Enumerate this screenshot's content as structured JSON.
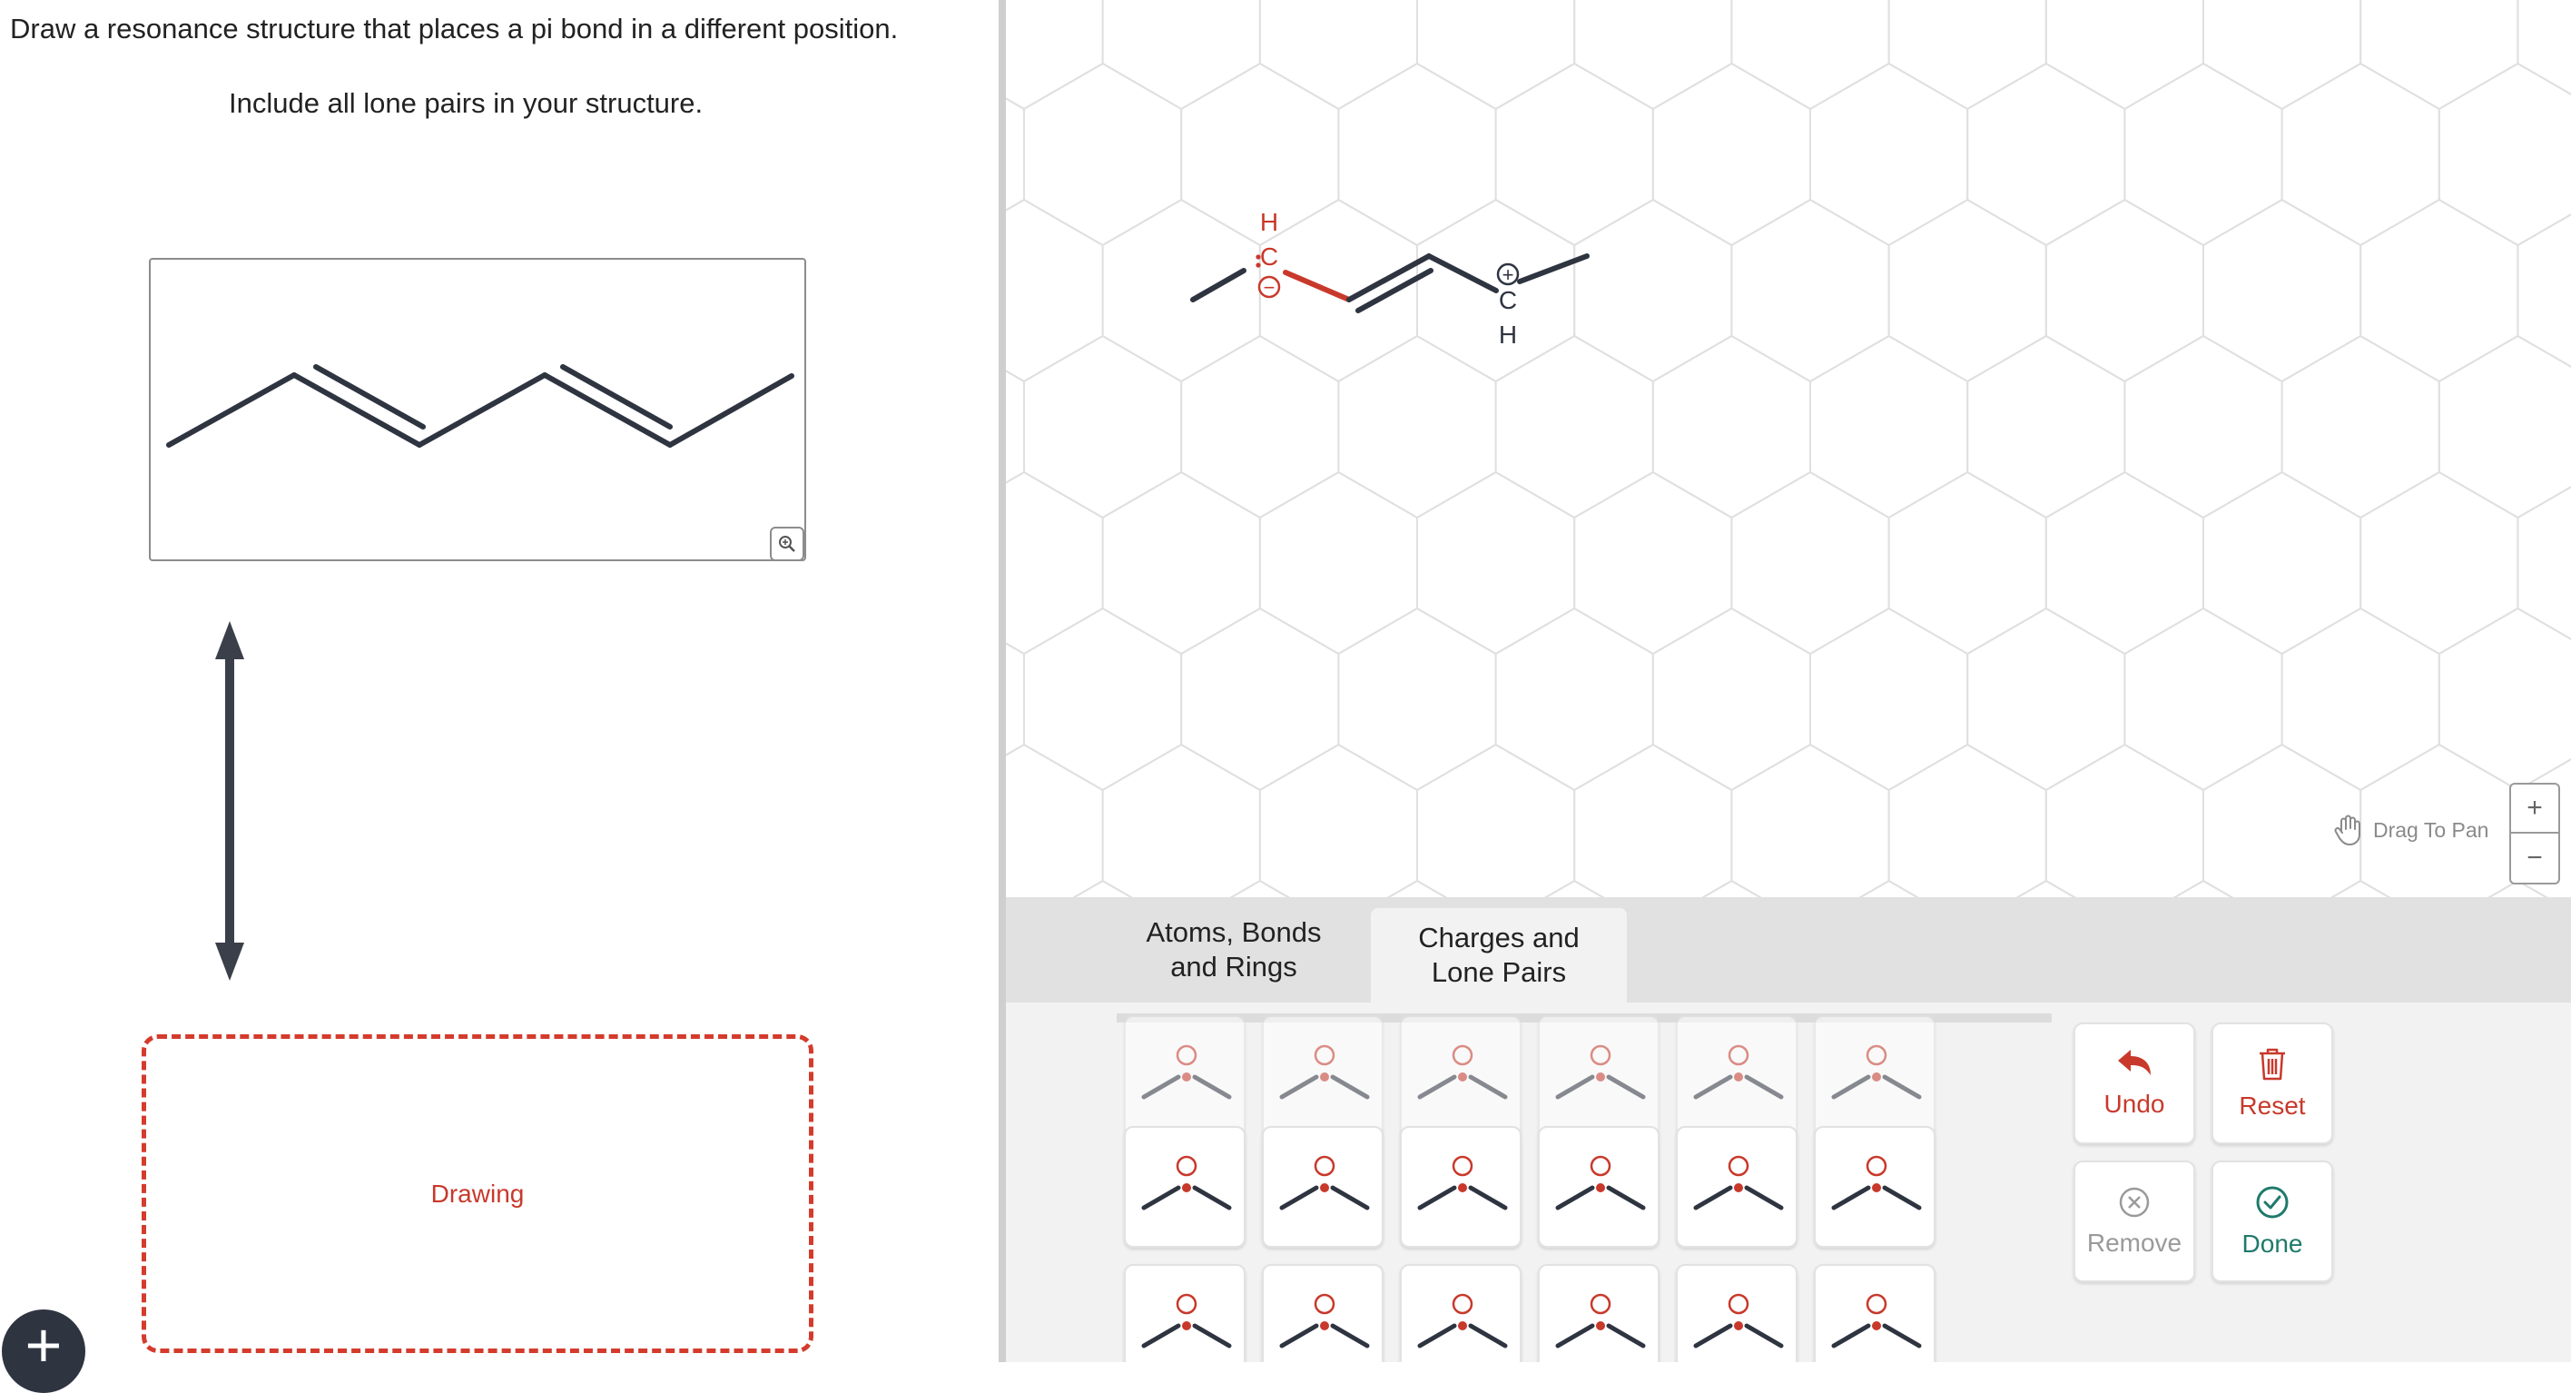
{
  "question": {
    "prompt": "Draw a resonance structure that places a pi bond in a different position.",
    "instruction": "Include all lone pairs in your structure."
  },
  "given_structure": {
    "zoom_icon": "zoom-in-icon"
  },
  "resonance_arrow": {
    "icon": "double-headed-arrow-icon"
  },
  "drawing_area": {
    "label": "Drawing"
  },
  "add_button": {
    "label": "+"
  },
  "canvas": {
    "molecule_labels": {
      "h_left": "H",
      "c_left": "C",
      "minus_left": "−",
      "plus_right": "+",
      "c_right": "C",
      "h_right": "H"
    },
    "drag_to_pan": "Drag To Pan",
    "zoom_in": "+",
    "zoom_out": "−"
  },
  "tabs": [
    {
      "label": "Atoms, Bonds and Rings",
      "line1": "Atoms, Bonds",
      "line2": "and Rings",
      "selected": false
    },
    {
      "label": "Charges and Lone Pairs",
      "line1": "Charges and",
      "line2": "Lone Pairs",
      "selected": true
    }
  ],
  "palette_tools": [
    "carbocation-lone-pair-tool",
    "carbanion-ch-tool",
    "hc-anion-tool",
    "anion-ch-bent-tool",
    "ch-radical-anion-tool",
    "hc-neutral-tool",
    "carbocation-tool",
    "carbanion-tool",
    "vinyl-ch-lone-pair-tool",
    "allyl-ch-lone-pair-tool",
    "allyl-ch-anion-tool",
    "vinyl-cation-tool",
    "vinyl-anion-lp-tool",
    "vinyl-anion-lp-2-tool",
    "vinyl-cation-lp-tool",
    "vinyl-anion-tool",
    "vinyl-anion-lp-3-tool",
    "vinyl-anion-lp-4-tool"
  ],
  "actions": {
    "undo": "Undo",
    "reset": "Reset",
    "remove": "Remove",
    "done": "Done"
  },
  "colors": {
    "accent_red": "#c8392b",
    "done_teal": "#1f7a6b",
    "bond_dark": "#2e3440",
    "grid_line": "#e0e0e0"
  }
}
